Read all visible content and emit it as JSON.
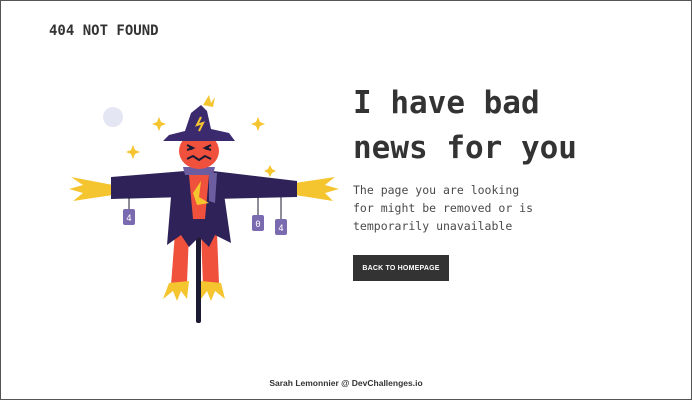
{
  "header": {
    "brand": "404 NOT FOUND"
  },
  "illustration": {
    "name": "scarecrow-illustration",
    "tag_texts": [
      "4",
      "0",
      "4"
    ]
  },
  "main": {
    "headline_line1": "I have bad",
    "headline_line2": "news for you",
    "message_line1": "The page you are looking",
    "message_line2": "for might be removed or is",
    "message_line3": "temporarily unavailable",
    "button_label": "BACK TO HOMEPAGE"
  },
  "footer": {
    "credit": "Sarah Lemonnier @ DevChallenges.io"
  },
  "colors": {
    "text": "#333333",
    "button_bg": "#333333",
    "button_text": "#ffffff",
    "hat": "#3b2a6e",
    "coat": "#2f2258",
    "face": "#f0513c",
    "straw": "#f5c530",
    "pole": "#1d1a33",
    "moon": "#e4e6f4"
  }
}
